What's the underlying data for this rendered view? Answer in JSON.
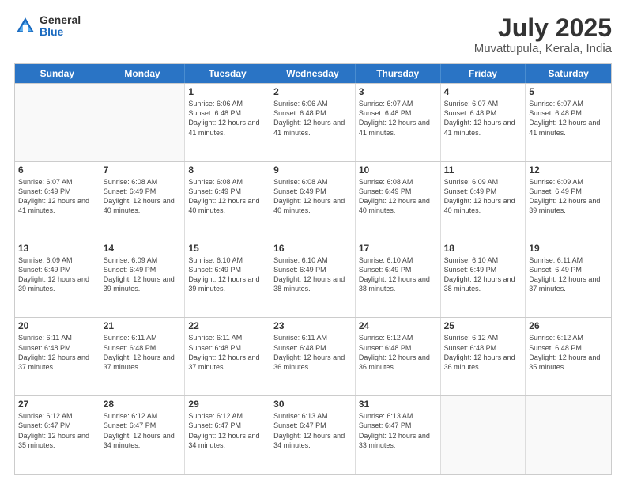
{
  "logo": {
    "general": "General",
    "blue": "Blue"
  },
  "title": "July 2025",
  "subtitle": "Muvattupula, Kerala, India",
  "weekdays": [
    "Sunday",
    "Monday",
    "Tuesday",
    "Wednesday",
    "Thursday",
    "Friday",
    "Saturday"
  ],
  "weeks": [
    [
      {
        "day": "",
        "sunrise": "",
        "sunset": "",
        "daylight": "",
        "empty": true
      },
      {
        "day": "",
        "sunrise": "",
        "sunset": "",
        "daylight": "",
        "empty": true
      },
      {
        "day": "1",
        "sunrise": "Sunrise: 6:06 AM",
        "sunset": "Sunset: 6:48 PM",
        "daylight": "Daylight: 12 hours and 41 minutes."
      },
      {
        "day": "2",
        "sunrise": "Sunrise: 6:06 AM",
        "sunset": "Sunset: 6:48 PM",
        "daylight": "Daylight: 12 hours and 41 minutes."
      },
      {
        "day": "3",
        "sunrise": "Sunrise: 6:07 AM",
        "sunset": "Sunset: 6:48 PM",
        "daylight": "Daylight: 12 hours and 41 minutes."
      },
      {
        "day": "4",
        "sunrise": "Sunrise: 6:07 AM",
        "sunset": "Sunset: 6:48 PM",
        "daylight": "Daylight: 12 hours and 41 minutes."
      },
      {
        "day": "5",
        "sunrise": "Sunrise: 6:07 AM",
        "sunset": "Sunset: 6:48 PM",
        "daylight": "Daylight: 12 hours and 41 minutes."
      }
    ],
    [
      {
        "day": "6",
        "sunrise": "Sunrise: 6:07 AM",
        "sunset": "Sunset: 6:49 PM",
        "daylight": "Daylight: 12 hours and 41 minutes."
      },
      {
        "day": "7",
        "sunrise": "Sunrise: 6:08 AM",
        "sunset": "Sunset: 6:49 PM",
        "daylight": "Daylight: 12 hours and 40 minutes."
      },
      {
        "day": "8",
        "sunrise": "Sunrise: 6:08 AM",
        "sunset": "Sunset: 6:49 PM",
        "daylight": "Daylight: 12 hours and 40 minutes."
      },
      {
        "day": "9",
        "sunrise": "Sunrise: 6:08 AM",
        "sunset": "Sunset: 6:49 PM",
        "daylight": "Daylight: 12 hours and 40 minutes."
      },
      {
        "day": "10",
        "sunrise": "Sunrise: 6:08 AM",
        "sunset": "Sunset: 6:49 PM",
        "daylight": "Daylight: 12 hours and 40 minutes."
      },
      {
        "day": "11",
        "sunrise": "Sunrise: 6:09 AM",
        "sunset": "Sunset: 6:49 PM",
        "daylight": "Daylight: 12 hours and 40 minutes."
      },
      {
        "day": "12",
        "sunrise": "Sunrise: 6:09 AM",
        "sunset": "Sunset: 6:49 PM",
        "daylight": "Daylight: 12 hours and 39 minutes."
      }
    ],
    [
      {
        "day": "13",
        "sunrise": "Sunrise: 6:09 AM",
        "sunset": "Sunset: 6:49 PM",
        "daylight": "Daylight: 12 hours and 39 minutes."
      },
      {
        "day": "14",
        "sunrise": "Sunrise: 6:09 AM",
        "sunset": "Sunset: 6:49 PM",
        "daylight": "Daylight: 12 hours and 39 minutes."
      },
      {
        "day": "15",
        "sunrise": "Sunrise: 6:10 AM",
        "sunset": "Sunset: 6:49 PM",
        "daylight": "Daylight: 12 hours and 39 minutes."
      },
      {
        "day": "16",
        "sunrise": "Sunrise: 6:10 AM",
        "sunset": "Sunset: 6:49 PM",
        "daylight": "Daylight: 12 hours and 38 minutes."
      },
      {
        "day": "17",
        "sunrise": "Sunrise: 6:10 AM",
        "sunset": "Sunset: 6:49 PM",
        "daylight": "Daylight: 12 hours and 38 minutes."
      },
      {
        "day": "18",
        "sunrise": "Sunrise: 6:10 AM",
        "sunset": "Sunset: 6:49 PM",
        "daylight": "Daylight: 12 hours and 38 minutes."
      },
      {
        "day": "19",
        "sunrise": "Sunrise: 6:11 AM",
        "sunset": "Sunset: 6:49 PM",
        "daylight": "Daylight: 12 hours and 37 minutes."
      }
    ],
    [
      {
        "day": "20",
        "sunrise": "Sunrise: 6:11 AM",
        "sunset": "Sunset: 6:48 PM",
        "daylight": "Daylight: 12 hours and 37 minutes."
      },
      {
        "day": "21",
        "sunrise": "Sunrise: 6:11 AM",
        "sunset": "Sunset: 6:48 PM",
        "daylight": "Daylight: 12 hours and 37 minutes."
      },
      {
        "day": "22",
        "sunrise": "Sunrise: 6:11 AM",
        "sunset": "Sunset: 6:48 PM",
        "daylight": "Daylight: 12 hours and 37 minutes."
      },
      {
        "day": "23",
        "sunrise": "Sunrise: 6:11 AM",
        "sunset": "Sunset: 6:48 PM",
        "daylight": "Daylight: 12 hours and 36 minutes."
      },
      {
        "day": "24",
        "sunrise": "Sunrise: 6:12 AM",
        "sunset": "Sunset: 6:48 PM",
        "daylight": "Daylight: 12 hours and 36 minutes."
      },
      {
        "day": "25",
        "sunrise": "Sunrise: 6:12 AM",
        "sunset": "Sunset: 6:48 PM",
        "daylight": "Daylight: 12 hours and 36 minutes."
      },
      {
        "day": "26",
        "sunrise": "Sunrise: 6:12 AM",
        "sunset": "Sunset: 6:48 PM",
        "daylight": "Daylight: 12 hours and 35 minutes."
      }
    ],
    [
      {
        "day": "27",
        "sunrise": "Sunrise: 6:12 AM",
        "sunset": "Sunset: 6:47 PM",
        "daylight": "Daylight: 12 hours and 35 minutes."
      },
      {
        "day": "28",
        "sunrise": "Sunrise: 6:12 AM",
        "sunset": "Sunset: 6:47 PM",
        "daylight": "Daylight: 12 hours and 34 minutes."
      },
      {
        "day": "29",
        "sunrise": "Sunrise: 6:12 AM",
        "sunset": "Sunset: 6:47 PM",
        "daylight": "Daylight: 12 hours and 34 minutes."
      },
      {
        "day": "30",
        "sunrise": "Sunrise: 6:13 AM",
        "sunset": "Sunset: 6:47 PM",
        "daylight": "Daylight: 12 hours and 34 minutes."
      },
      {
        "day": "31",
        "sunrise": "Sunrise: 6:13 AM",
        "sunset": "Sunset: 6:47 PM",
        "daylight": "Daylight: 12 hours and 33 minutes."
      },
      {
        "day": "",
        "sunrise": "",
        "sunset": "",
        "daylight": "",
        "empty": true
      },
      {
        "day": "",
        "sunrise": "",
        "sunset": "",
        "daylight": "",
        "empty": true
      }
    ]
  ]
}
